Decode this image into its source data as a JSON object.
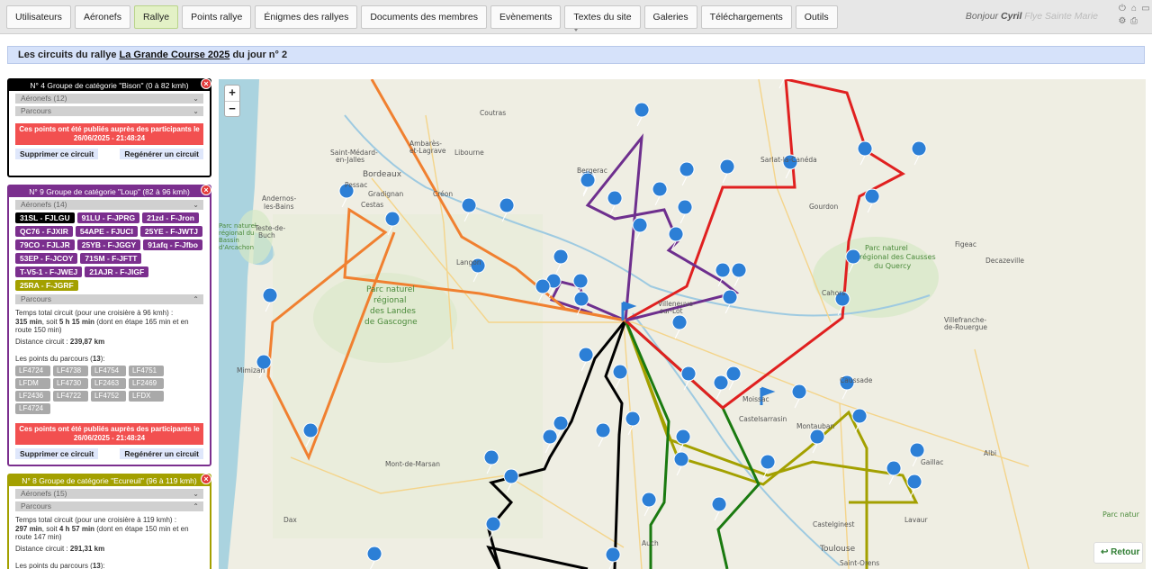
{
  "nav": {
    "tabs": [
      "Utilisateurs",
      "Aéronefs",
      "Rallye",
      "Points rallye",
      "Énigmes des rallyes",
      "Documents des membres",
      "Evènements",
      "Textes du site",
      "Galeries",
      "Téléchargements",
      "Outils"
    ],
    "active": "Rallye",
    "greeting_prefix": "Bonjour",
    "greeting_name": "Cyril",
    "greeting_rest": "Flye Sainte Marie"
  },
  "title": {
    "prefix": "Les circuits du rallye",
    "rally": "La Grande Course 2025",
    "suffix": "du jour n° 2"
  },
  "groups": [
    {
      "header": "N° 4 Groupe de catégorie \"Bison\" (0 à 82 kmh)",
      "color": "#000000",
      "aircraft_label": "Aéronefs (12)",
      "route_label": "Parcours",
      "published": "Ces points ont été publiés auprès des participants le 26/06/2025 - 21:48:24",
      "delete": "Supprimer ce circuit",
      "regen": "Regénérer un circuit"
    },
    {
      "header": "N° 9 Groupe de catégorie \"Loup\" (82 à 96 kmh)",
      "color": "#7b2f8e",
      "aircraft_label": "Aéronefs (14)",
      "aircraft": [
        "31SL - FJLGU",
        "91LU - F-JPRG",
        "21zd - F-Jron",
        "QC76 - FJXIR",
        "54APE - FJUCI",
        "25YE - F-JWTJ",
        "79CO - FJLJR",
        "25YB - F-JGGY",
        "91afq - F-Jfbo",
        "53EP - F-JCOY",
        "71SM - F-JFTT",
        "T-V5-1 - F-JWEJ",
        "21AJR - F-JIGF",
        "25RA - F-JGRF"
      ],
      "route_label": "Parcours",
      "total_time_l1": "Temps total circuit (pour une croisière à 96 kmh) :",
      "total_time_min": "315 min",
      "total_time_sep": ", soit ",
      "total_time_h": "5 h 15 min",
      "total_time_rest": " (dont en étape 165 min et en route 150 min)",
      "distance_label": "Distance circuit :",
      "distance": "239,87 km",
      "points_label": "Les points du parcours (",
      "points_count": "13",
      "points_tail": "):",
      "points": [
        "LF4724",
        "LF4738",
        "LF4754",
        "LF4751",
        "LFDM",
        "LF4730",
        "LF2463",
        "LF2469",
        "LF2436",
        "LF4722",
        "LF4752",
        "LFDX",
        "LF4724"
      ],
      "published": "Ces points ont été publiés auprès des participants le 26/06/2025 - 21:48:24",
      "delete": "Supprimer ce circuit",
      "regen": "Regénérer un circuit"
    },
    {
      "header": "N° 8 Groupe de catégorie \"Ecureuil\" (96 à 119 kmh)",
      "color": "#a3a000",
      "aircraft_label": "Aéronefs (15)",
      "route_label": "Parcours",
      "total_time_l1": "Temps total circuit (pour une croisière à 119 kmh) :",
      "total_time_min": "297 min",
      "total_time_sep": ", soit ",
      "total_time_h": "4 h 57 min",
      "total_time_rest": " (dont en étape 150 min et en route 147 min)",
      "distance_label": "Distance circuit :",
      "distance": "291,31 km",
      "points_label": "Les points du parcours (",
      "points_count": "13",
      "points_tail": "):"
    }
  ],
  "map": {
    "zoom_in": "+",
    "zoom_out": "−",
    "back_label": "Retour",
    "places": [
      "Coutras",
      "Saint-Médard-en-Jalles",
      "Ambarès-et-Lagrave",
      "Libourne",
      "Bordeaux",
      "Pessac",
      "Gradignan",
      "Créon",
      "Andernos-les-Bains",
      "Cestas",
      "Teste-de-Buch",
      "Parc naturel régional du Bassin d'Arcachon",
      "Langon",
      "Parc naturel régional des Landes de Gascogne",
      "Mimizan",
      "Mont-de-Marsan",
      "Dax",
      "Bergerac",
      "Sarlat-la-Canéda",
      "Gourdon",
      "Figeac",
      "Decazeville",
      "Parc naturel régional des Causses du Quercy",
      "Cahors",
      "Villeneuve-sur-Lot",
      "Villefranche-de-Rouergue",
      "Moissac",
      "Castelsarrasin",
      "Caussade",
      "Montauban",
      "Albi",
      "Gaillac",
      "Lavaur",
      "Castelginest",
      "Auch",
      "Toulouse",
      "Saint-Orens",
      "Parc natur"
    ],
    "route_colors": {
      "bison": "#000000",
      "loup": "#6e2f8e",
      "ecureuil": "#a3a000",
      "orange": "#f08030",
      "red": "#e02020",
      "green": "#1a7a10"
    }
  }
}
